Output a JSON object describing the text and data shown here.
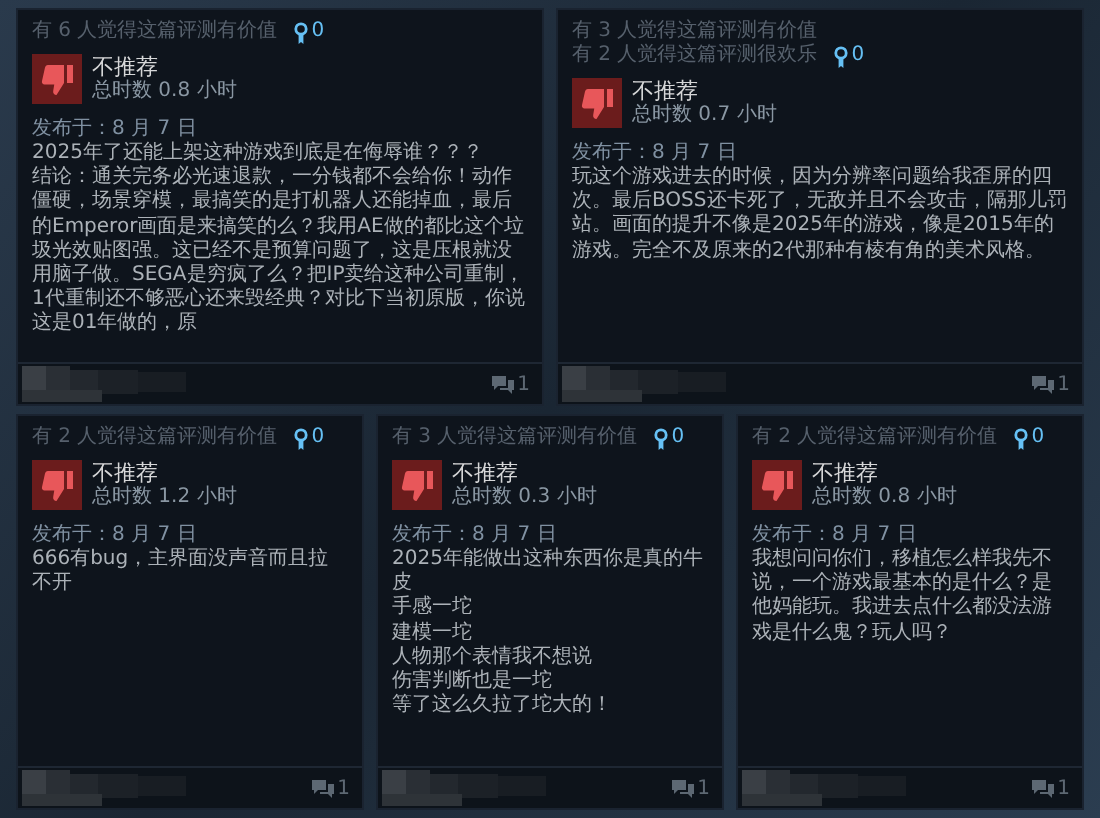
{
  "reviews": [
    {
      "helpful": [
        "有 6 人觉得这篇评测有价值"
      ],
      "awards": "0",
      "verdict": "不推荐",
      "recommended": false,
      "hours": "总时数 0.8 小时",
      "posted": "发布于：8 月 7 日",
      "body": [
        "2025年了还能上架这种游戏到底是在侮辱谁？？？",
        "结论：通关完务必光速退款，一分钱都不会给你！动作僵硬，场景穿模，最搞笑的是打机器人还能掉血，最后的Emperor画面是来搞笑的么？我用AE做的都比这个垃圾光效贴图强。这已经不是预算问题了，这是压根就没用脑子做。SEGA是穷疯了么？把IP卖给这种公司重制，1代重制还不够恶心还来毁经典？对比下当初原版，你说这是01年做的，原"
      ],
      "comments": "1"
    },
    {
      "helpful": [
        "有 3 人觉得这篇评测有价值",
        "有 2 人觉得这篇评测很欢乐"
      ],
      "awards": "0",
      "verdict": "不推荐",
      "recommended": false,
      "hours": "总时数 0.7 小时",
      "posted": "发布于：8 月 7 日",
      "body": [
        "玩这个游戏进去的时候，因为分辨率问题给我歪屏的四次。最后BOSS还卡死了，无敌并且不会攻击，隔那儿罚站。画面的提升不像是2025年的游戏，像是2015年的游戏。完全不及原来的2代那种有棱有角的美术风格。"
      ],
      "comments": "1"
    },
    {
      "helpful": [
        "有 2 人觉得这篇评测有价值"
      ],
      "awards": "0",
      "verdict": "不推荐",
      "recommended": false,
      "hours": "总时数 1.2 小时",
      "posted": "发布于：8 月 7 日",
      "body": [
        "666有bug，主界面没声音而且拉不开"
      ],
      "comments": "1"
    },
    {
      "helpful": [
        "有 3 人觉得这篇评测有价值"
      ],
      "awards": "0",
      "verdict": "不推荐",
      "recommended": false,
      "hours": "总时数 0.3 小时",
      "posted": "发布于：8 月 7 日",
      "body": [
        "2025年能做出这种东西你是真的牛皮",
        "手感一坨",
        "建模一坨",
        "人物那个表情我不想说",
        "伤害判断也是一坨",
        "等了这么久拉了坨大的！"
      ],
      "comments": "1"
    },
    {
      "helpful": [
        "有 2 人觉得这篇评测有价值"
      ],
      "awards": "0",
      "verdict": "不推荐",
      "recommended": false,
      "hours": "总时数 0.8 小时",
      "posted": "发布于：8 月 7 日",
      "body": [
        "我想问问你们，移植怎么样我先不说，一个游戏最基本的是什么？是他妈能玩。我进去点什么都没法游戏是什么鬼？玩人吗？"
      ],
      "comments": "1"
    }
  ]
}
